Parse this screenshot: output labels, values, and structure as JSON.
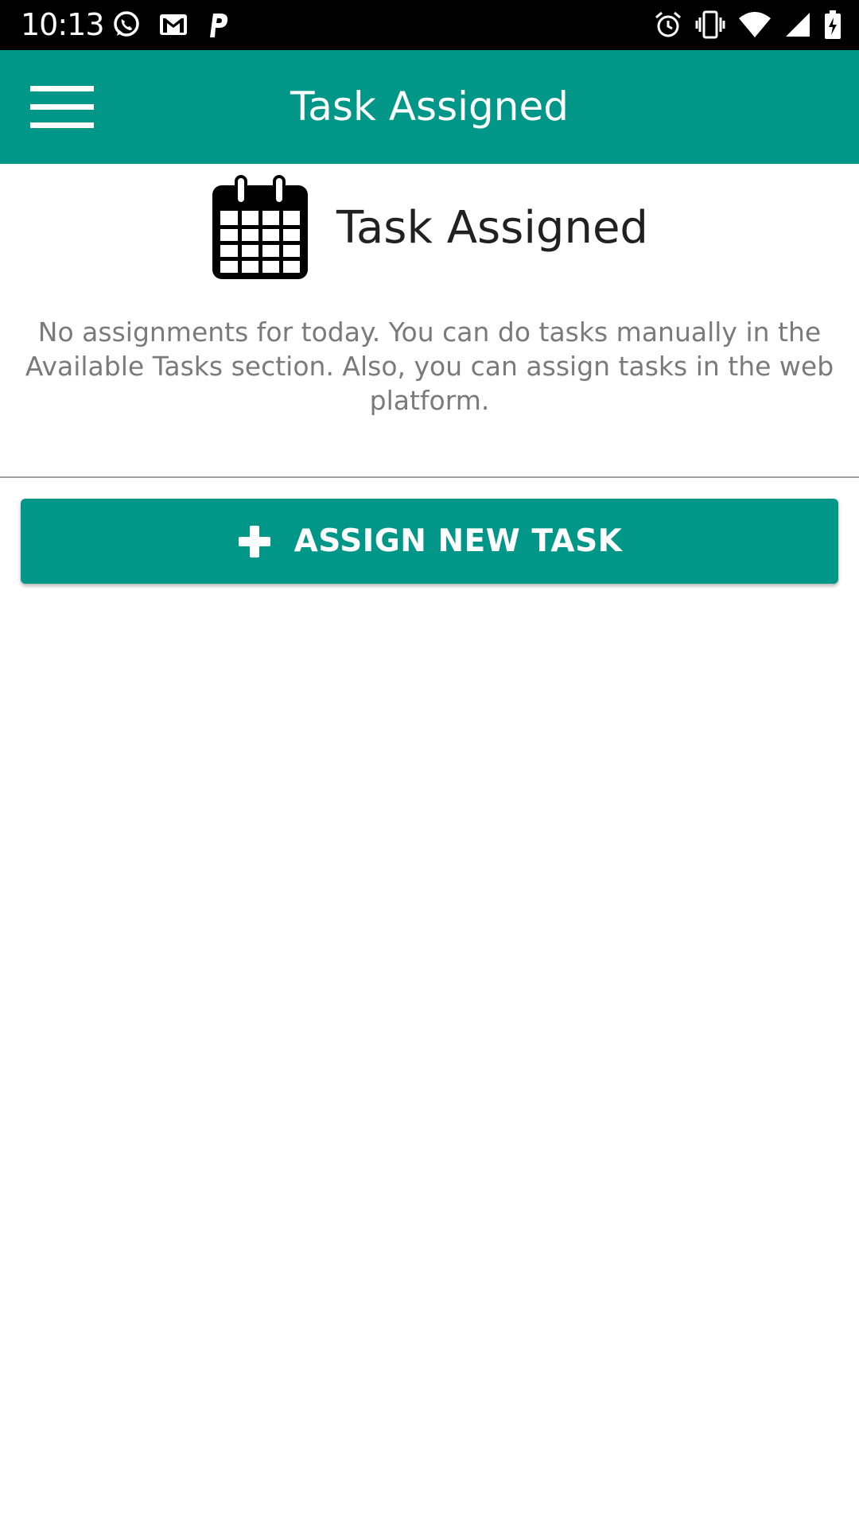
{
  "status_bar": {
    "time": "10:13",
    "left_icons": [
      "whatsapp-icon",
      "gmail-icon",
      "p-app-icon"
    ],
    "right_icons": [
      "alarm-icon",
      "vibrate-icon",
      "wifi-icon",
      "signal-icon",
      "battery-icon"
    ]
  },
  "app_bar": {
    "title": "Task Assigned",
    "menu_icon": "hamburger-menu-icon",
    "background": "#009688"
  },
  "content": {
    "icon": "calendar-icon",
    "title": "Task Assigned",
    "message": "No assignments for today. You can do tasks manually in the Available Tasks section. Also, you can assign tasks in the web platform."
  },
  "assign_button": {
    "icon": "plus-icon",
    "label": "ASSIGN NEW TASK",
    "background": "#009688"
  }
}
